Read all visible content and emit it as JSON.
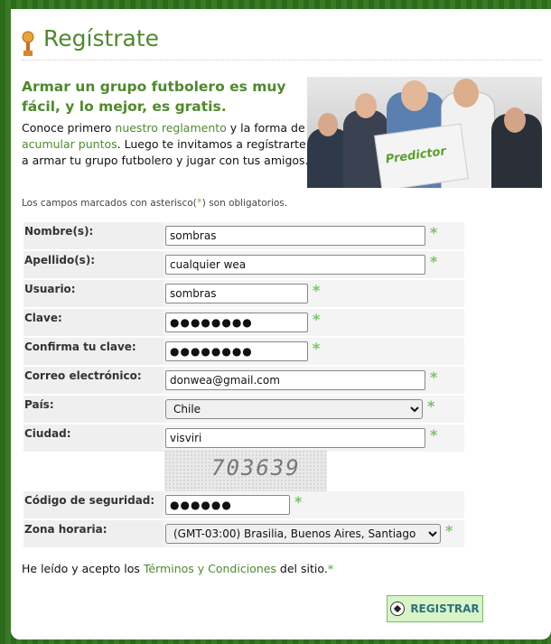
{
  "page": {
    "title": "Regístrate",
    "headline": "Armar un grupo futbolero es muy fácil, y lo mejor, es gratis.",
    "intro_before_link1": "Conoce primero ",
    "link_reglamento": "nuestro reglamento",
    "intro_between_links": " y la forma de ",
    "link_puntos": "acumular puntos",
    "intro_after_link2": ". Luego te invitamos a regístrarte y a armar tu grupo futbolero y jugar con tus amigos.",
    "promo_logo_text": "Predictor",
    "required_note_before": "Los campos marcados con asterisco(",
    "required_note_star": "*",
    "required_note_after": ") son obligatorios."
  },
  "form": {
    "fields": [
      {
        "label": "Nombre(s):",
        "value": "sombras"
      },
      {
        "label": "Apellido(s):",
        "value": "cualquier wea"
      },
      {
        "label": "Usuario:",
        "value": "sombras"
      },
      {
        "label": "Clave:",
        "value": "●●●●●●●●"
      },
      {
        "label": "Confirma tu clave:",
        "value": "●●●●●●●●"
      },
      {
        "label": "Correo electrónico:",
        "value": "donwea@gmail.com"
      },
      {
        "label": "País:",
        "value": "Chile"
      },
      {
        "label": "Ciudad:",
        "value": "visviri"
      },
      {
        "label": "Código de seguridad:",
        "value": "●●●●●●"
      },
      {
        "label": "Zona horaria:",
        "value": "(GMT-03:00) Brasilia, Buenos Aires, Santiago"
      }
    ],
    "captcha_text": "703639",
    "required_mark": "*"
  },
  "terms": {
    "before": "He leído y acepto los ",
    "link": "Términos y Condiciones",
    "after": " del sitio."
  },
  "submit_label": "REGISTRAR",
  "colors": {
    "accent": "#4e8a2c",
    "required": "#7ac36a",
    "button_bg": "#d8f5c8"
  }
}
